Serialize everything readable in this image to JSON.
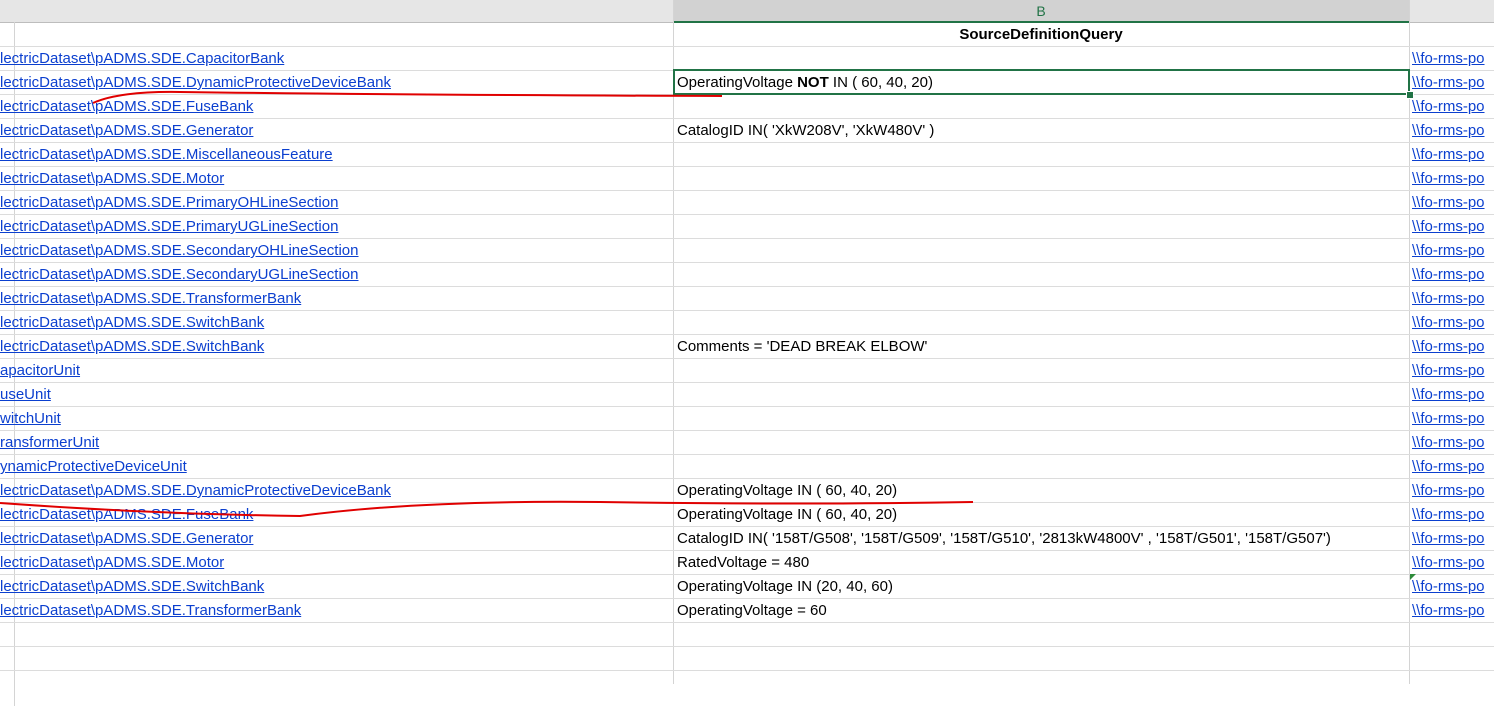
{
  "columns": {
    "b_letter": "B"
  },
  "header": {
    "b": "SourceDefinitionQuery"
  },
  "rows": [
    {
      "a": "lectricDataset\\pADMS.SDE.CapacitorBank",
      "b": "",
      "c": "\\\\fo-rms-po"
    },
    {
      "a": "lectricDataset\\pADMS.SDE.DynamicProtectiveDeviceBank",
      "b_pre": "OperatingVoltage ",
      "b_bold": "NOT",
      "b_post": " IN ( 60, 40, 20)",
      "c": "\\\\fo-rms-po"
    },
    {
      "a": "lectricDataset\\pADMS.SDE.FuseBank",
      "b": "",
      "c": "\\\\fo-rms-po"
    },
    {
      "a": "lectricDataset\\pADMS.SDE.Generator",
      "b": "CatalogID IN( 'XkW208V', 'XkW480V' )",
      "c": "\\\\fo-rms-po"
    },
    {
      "a": "lectricDataset\\pADMS.SDE.MiscellaneousFeature",
      "b": "",
      "c": "\\\\fo-rms-po"
    },
    {
      "a": "lectricDataset\\pADMS.SDE.Motor",
      "b": "",
      "c": "\\\\fo-rms-po"
    },
    {
      "a": "lectricDataset\\pADMS.SDE.PrimaryOHLineSection",
      "b": "",
      "c": "\\\\fo-rms-po"
    },
    {
      "a": "lectricDataset\\pADMS.SDE.PrimaryUGLineSection",
      "b": "",
      "c": "\\\\fo-rms-po"
    },
    {
      "a": "lectricDataset\\pADMS.SDE.SecondaryOHLineSection",
      "b": "",
      "c": "\\\\fo-rms-po"
    },
    {
      "a": "lectricDataset\\pADMS.SDE.SecondaryUGLineSection",
      "b": "",
      "c": "\\\\fo-rms-po"
    },
    {
      "a": "lectricDataset\\pADMS.SDE.TransformerBank",
      "b": "",
      "c": "\\\\fo-rms-po"
    },
    {
      "a": "lectricDataset\\pADMS.SDE.SwitchBank",
      "b": "",
      "c": "\\\\fo-rms-po"
    },
    {
      "a": "lectricDataset\\pADMS.SDE.SwitchBank",
      "b": "Comments = 'DEAD BREAK ELBOW'",
      "c": "\\\\fo-rms-po"
    },
    {
      "a": "apacitorUnit",
      "b": "",
      "c": "\\\\fo-rms-po"
    },
    {
      "a": "useUnit",
      "b": "",
      "c": "\\\\fo-rms-po"
    },
    {
      "a": "witchUnit",
      "b": "",
      "c": "\\\\fo-rms-po"
    },
    {
      "a": "ransformerUnit",
      "b": "",
      "c": "\\\\fo-rms-po"
    },
    {
      "a": "ynamicProtectiveDeviceUnit",
      "b": "",
      "c": "\\\\fo-rms-po"
    },
    {
      "a": "lectricDataset\\pADMS.SDE.DynamicProtectiveDeviceBank",
      "b": "OperatingVoltage IN ( 60, 40, 20)",
      "c": "\\\\fo-rms-po"
    },
    {
      "a": "lectricDataset\\pADMS.SDE.FuseBank",
      "b": "OperatingVoltage IN ( 60, 40, 20)",
      "c": "\\\\fo-rms-po"
    },
    {
      "a": "lectricDataset\\pADMS.SDE.Generator",
      "b": "CatalogID IN( '158T/G508', '158T/G509', '158T/G510', '2813kW4800V' , '158T/G501', '158T/G507')",
      "c": "\\\\fo-rms-po"
    },
    {
      "a": "lectricDataset\\pADMS.SDE.Motor",
      "b": "RatedVoltage = 480",
      "c": "\\\\fo-rms-po"
    },
    {
      "a": "lectricDataset\\pADMS.SDE.SwitchBank",
      "b": "OperatingVoltage IN (20, 40, 60)",
      "c": "\\\\fo-rms-po"
    },
    {
      "a": "lectricDataset\\pADMS.SDE.TransformerBank",
      "b": "OperatingVoltage = 60",
      "c": "\\\\fo-rms-po"
    }
  ],
  "annotation_color": "#e00000",
  "accent_color": "#217346",
  "link_color": "#0b3fcf"
}
